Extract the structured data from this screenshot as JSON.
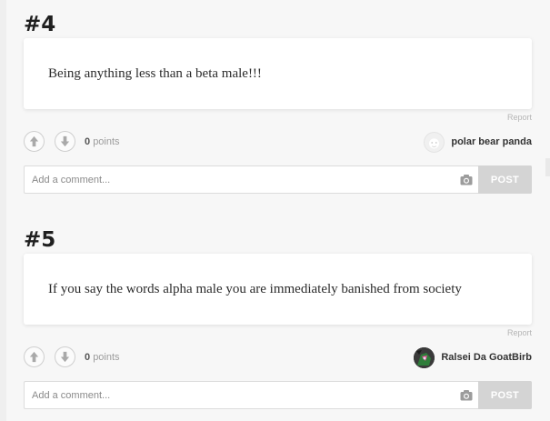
{
  "entries": [
    {
      "rank": "#4",
      "text": "Being anything less than a beta male!!!",
      "report_label": "Report",
      "points_value": "0",
      "points_label": "points",
      "author": "polar bear panda",
      "comment_placeholder": "Add a comment...",
      "post_label": "POST"
    },
    {
      "rank": "#5",
      "text": "If you say the words alpha male you are immediately banished from society",
      "report_label": "Report",
      "points_value": "0",
      "points_label": "points",
      "author": "Ralsei Da GoatBirb",
      "comment_placeholder": "Add a comment...",
      "post_label": "POST"
    }
  ],
  "icons": [
    "arrow-up-icon",
    "arrow-down-icon",
    "camera-icon"
  ],
  "colors": {
    "background": "#f7f7f7",
    "card": "#ffffff",
    "post_button": "#d4d4d4",
    "text": "#2b2b2b"
  }
}
